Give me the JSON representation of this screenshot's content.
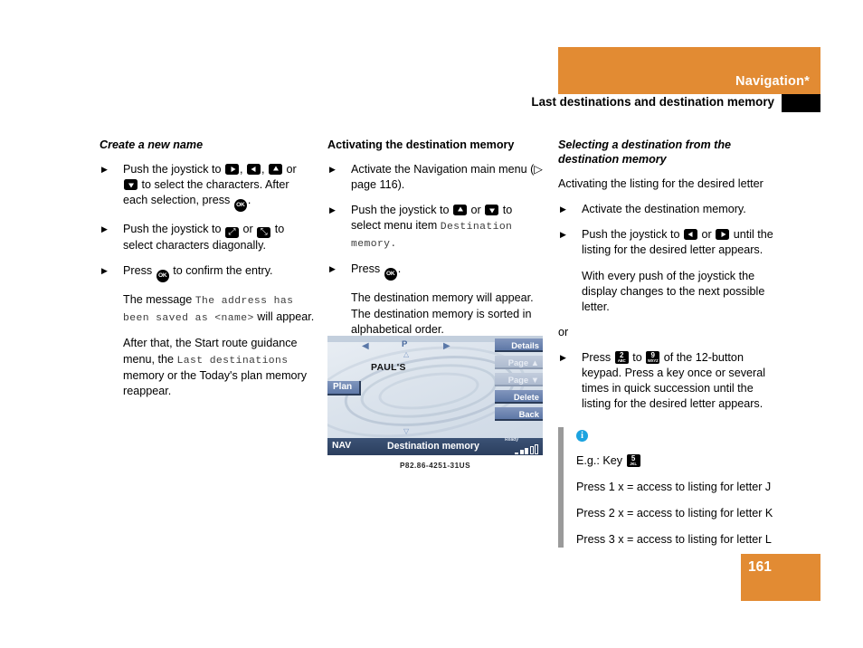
{
  "header": {
    "chapter": "Navigation*",
    "subtitle": "Last destinations and destination memory"
  },
  "page_number": "161",
  "columns": {
    "left": {
      "heading": "Create a new name",
      "b1_a": "Push the joystick to ",
      "b1_b": ", ",
      "b1_c": ", ",
      "b1_d": " or",
      "b1_e": " to select the characters. After each selection, press ",
      "b1_f": ".",
      "b2_a": "Push the joystick to ",
      "b2_b": " or ",
      "b2_c": " to select characters diagonally.",
      "b3_a": "Press ",
      "b3_b": " to confirm the entry.",
      "p1_a": "The message ",
      "p1_mono": "The address has been saved as <name>",
      "p1_b": " will appear.",
      "p2_a": "After that, the Start route guidance menu, the ",
      "p2_mono": "Last destinations",
      "p2_b": " memory or the Today's plan memory reappear."
    },
    "middle": {
      "heading": "Activating the destination memory",
      "b1": "Activate the Navigation main menu (▷ page 116).",
      "b2_a": "Push the joystick to ",
      "b2_b": " or ",
      "b2_c": " to select menu item ",
      "b2_mono": "Destination memory.",
      "b3_a": "Press ",
      "b3_b": ".",
      "p1": "The destination memory will appear. The destination memory is sorted in alphabetical order."
    },
    "right": {
      "heading": "Selecting a destination from the destination memory",
      "lead": "Activating the listing for the desired letter",
      "b1": "Activate the destination memory.",
      "b2_a": "Push the joystick to ",
      "b2_b": " or ",
      "b2_c": " until the listing for the desired letter appears.",
      "p1": "With every push of the joystick the display changes to the next possible letter.",
      "or": "or",
      "b3_a": "Press ",
      "b3_b": " to ",
      "b3_c": " of the 12-button keypad. Press a key once or several times in quick succession until the listing for the desired letter appears.",
      "note": {
        "example_label": "E.g.: Key ",
        "line1": "Press 1 x = access to listing for letter J",
        "line2": "Press 2 x = access to listing for letter K",
        "line3": "Press 3 x = access to listing for letter L"
      }
    }
  },
  "keys": {
    "k2_num": "2",
    "k2_sub": "ABC",
    "k9_num": "9",
    "k9_sub": "WXYZ",
    "k5_num": "5",
    "k5_sub": "JKL",
    "ok": "OK",
    "info": "i"
  },
  "nav_display": {
    "pointer_label": "P",
    "entry_name": "PAUL'S",
    "plan_button": "Plan",
    "buttons": [
      "Details",
      "Page ▲",
      "Page ▼",
      "Delete",
      "Back"
    ],
    "status_left": "NAV",
    "status_title": "Destination memory",
    "status_ready": "Ready",
    "caption": "P82.86-4251-31US"
  },
  "colors": {
    "accent_orange": "#e28b33",
    "info_blue": "#1ba3e0",
    "nav_button_blue": "#5d77a6",
    "nav_status_blue": "#2b3e5e"
  }
}
